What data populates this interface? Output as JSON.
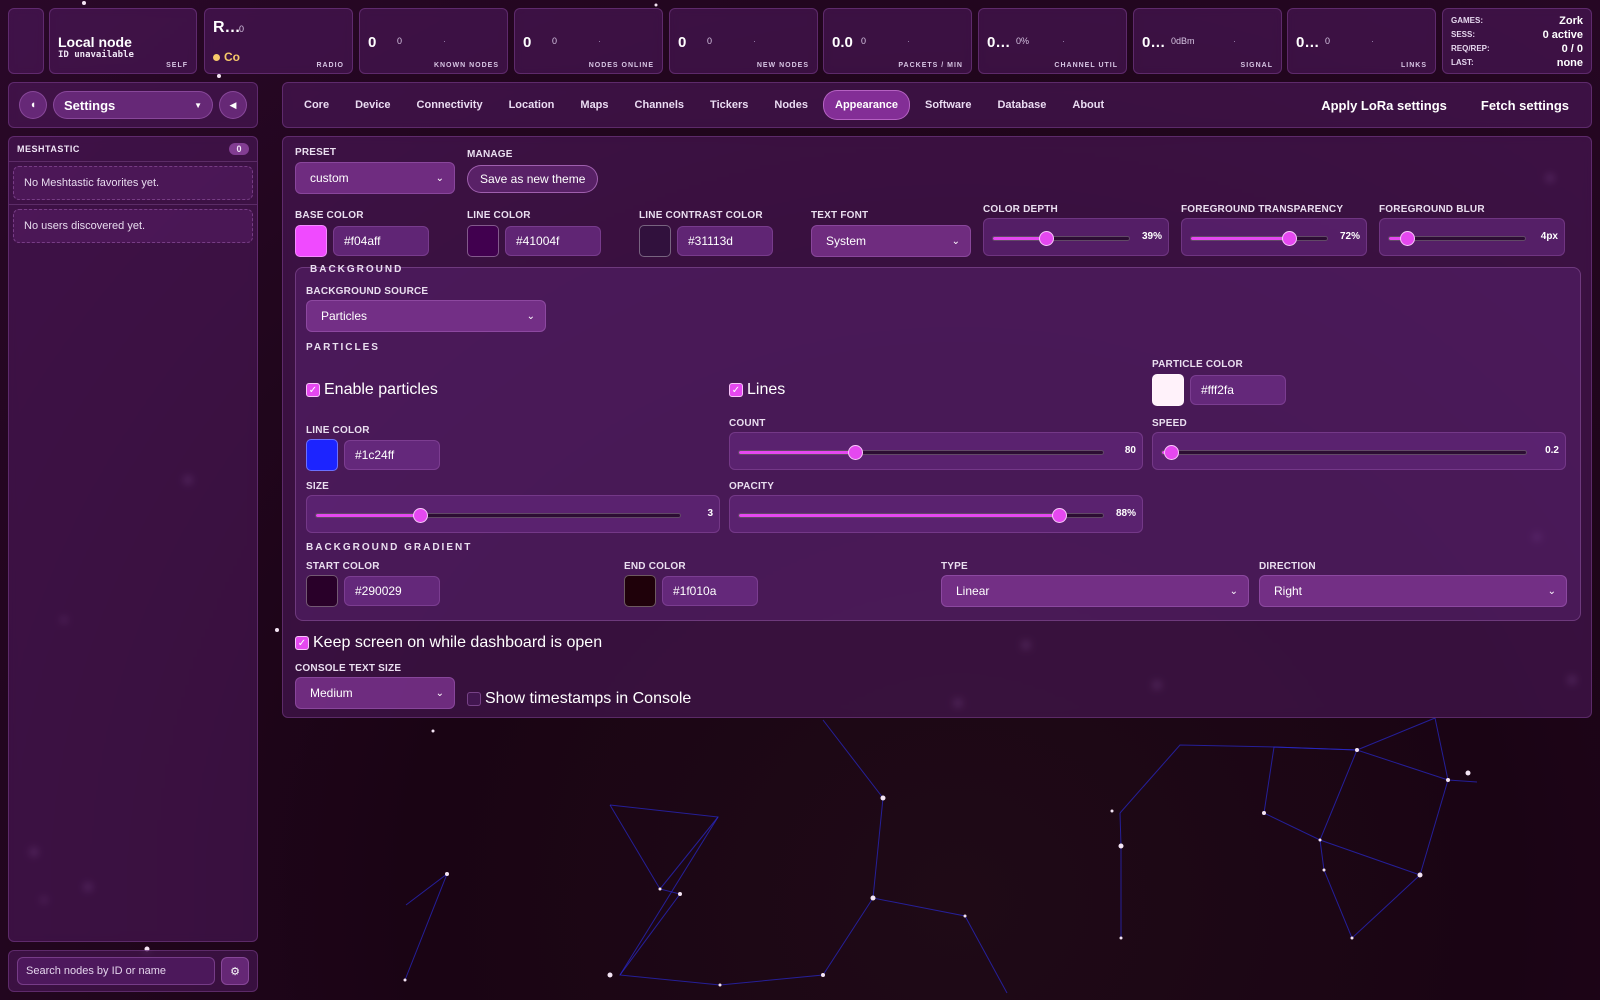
{
  "topbar": {
    "self": {
      "title": "Local node",
      "sub": "ID unavailable",
      "cap": "SELF"
    },
    "radio": {
      "big": "R…",
      "small": "0",
      "status": "Co",
      "cap": "RADIO"
    },
    "known_nodes": {
      "big": "0",
      "small": "0",
      "cap": "KNOWN NODES"
    },
    "nodes_online": {
      "big": "0",
      "small": "0",
      "cap": "NODES ONLINE"
    },
    "new_nodes": {
      "big": "0",
      "small": "0",
      "cap": "NEW NODES"
    },
    "packets_min": {
      "big": "0.0",
      "small": "0",
      "cap": "PACKETS / MIN"
    },
    "channel_util": {
      "big": "0…",
      "small": "0%",
      "cap": "CHANNEL UTIL"
    },
    "signal": {
      "big": "0…",
      "small": "0dBm",
      "cap": "SIGNAL"
    },
    "links": {
      "big": "0…",
      "small": "0",
      "cap": "LINKS"
    },
    "games": {
      "games_label": "GAMES:",
      "games_value": "Zork",
      "sess_label": "SESS:",
      "sess_value": "0 active",
      "req_label": "REQ/REP:",
      "req_value": "0 / 0",
      "last_label": "LAST:",
      "last_value": "none"
    }
  },
  "sidebar": {
    "settings_label": "Settings",
    "section_title": "MESHTASTIC",
    "section_count": "0",
    "favorites_empty": "No Meshtastic favorites yet.",
    "users_empty": "No users discovered yet.",
    "search_placeholder": "Search nodes by ID or name"
  },
  "tabs": [
    {
      "label": "Core"
    },
    {
      "label": "Device"
    },
    {
      "label": "Connectivity"
    },
    {
      "label": "Location"
    },
    {
      "label": "Maps"
    },
    {
      "label": "Channels"
    },
    {
      "label": "Tickers"
    },
    {
      "label": "Nodes"
    },
    {
      "label": "Appearance"
    },
    {
      "label": "Software"
    },
    {
      "label": "Database"
    },
    {
      "label": "About"
    }
  ],
  "active_tab": "Appearance",
  "actions": {
    "apply": "Apply LoRa settings",
    "fetch": "Fetch settings"
  },
  "appearance": {
    "preset_label": "PRESET",
    "preset_value": "custom",
    "manage_label": "MANAGE",
    "save_theme": "Save as new theme",
    "base_color_label": "BASE COLOR",
    "base_color": "#f04aff",
    "line_color_label": "LINE COLOR",
    "line_color": "#41004f",
    "line_contrast_label": "LINE CONTRAST COLOR",
    "line_contrast_color": "#31113d",
    "text_font_label": "TEXT FONT",
    "text_font": "System",
    "color_depth_label": "COLOR DEPTH",
    "color_depth": 39,
    "color_depth_text": "39%",
    "fg_transparency_label": "FOREGROUND TRANSPARENCY",
    "fg_transparency": 72,
    "fg_transparency_text": "72%",
    "fg_blur_label": "FOREGROUND BLUR",
    "fg_blur": 4,
    "fg_blur_text": "4px",
    "background": {
      "title": "BACKGROUND",
      "source_label": "BACKGROUND SOURCE",
      "source": "Particles",
      "particles_title": "PARTICLES",
      "enable_particles": "Enable particles",
      "lines": "Lines",
      "particle_color_label": "PARTICLE COLOR",
      "particle_color": "#fff2fa",
      "line_color_label": "LINE COLOR",
      "line_color": "#1c24ff",
      "count_label": "COUNT",
      "count": 80,
      "count_text": "80",
      "speed_label": "SPEED",
      "speed": 0.2,
      "speed_text": "0.2",
      "size_label": "SIZE",
      "size": 3,
      "size_text": "3",
      "opacity_label": "OPACITY",
      "opacity": 88,
      "opacity_text": "88%"
    },
    "gradient": {
      "title": "BACKGROUND GRADIENT",
      "start_label": "START COLOR",
      "start": "#290029",
      "end_label": "END COLOR",
      "end": "#1f010a",
      "type_label": "TYPE",
      "type": "Linear",
      "direction_label": "DIRECTION",
      "direction": "Right"
    },
    "keep_screen": "Keep screen on while dashboard is open",
    "console_size_label": "CONSOLE TEXT SIZE",
    "console_size": "Medium",
    "show_timestamps": "Show timestamps in Console"
  },
  "colors": {
    "accent": "#e548f0",
    "status_dot": "#f7c96a"
  }
}
